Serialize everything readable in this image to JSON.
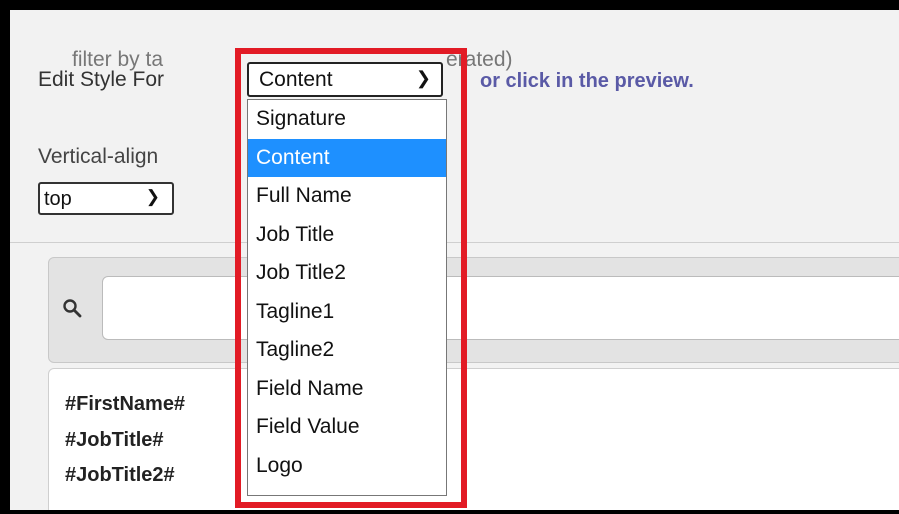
{
  "edit_style": {
    "label": "Edit Style For",
    "selected": "Content",
    "hint": "or click in the preview."
  },
  "dropdown": {
    "options": [
      "Signature",
      "Content",
      "Full Name",
      "Job Title",
      "Job Title2",
      "Tagline1",
      "Tagline2",
      "Field Name",
      "Field Value",
      "Logo"
    ],
    "selected_index": 1
  },
  "vertical_align": {
    "label": "Vertical-align",
    "value": "top"
  },
  "filter": {
    "placeholder_left": "filter by ta",
    "placeholder_right": "erated)"
  },
  "preview": {
    "lines": [
      "#FirstName#",
      "#JobTitle#",
      "#JobTitle2#"
    ]
  },
  "colors": {
    "highlight": "#e21b25",
    "selected_option": "#1e90ff",
    "link": "#5a5aa6"
  }
}
